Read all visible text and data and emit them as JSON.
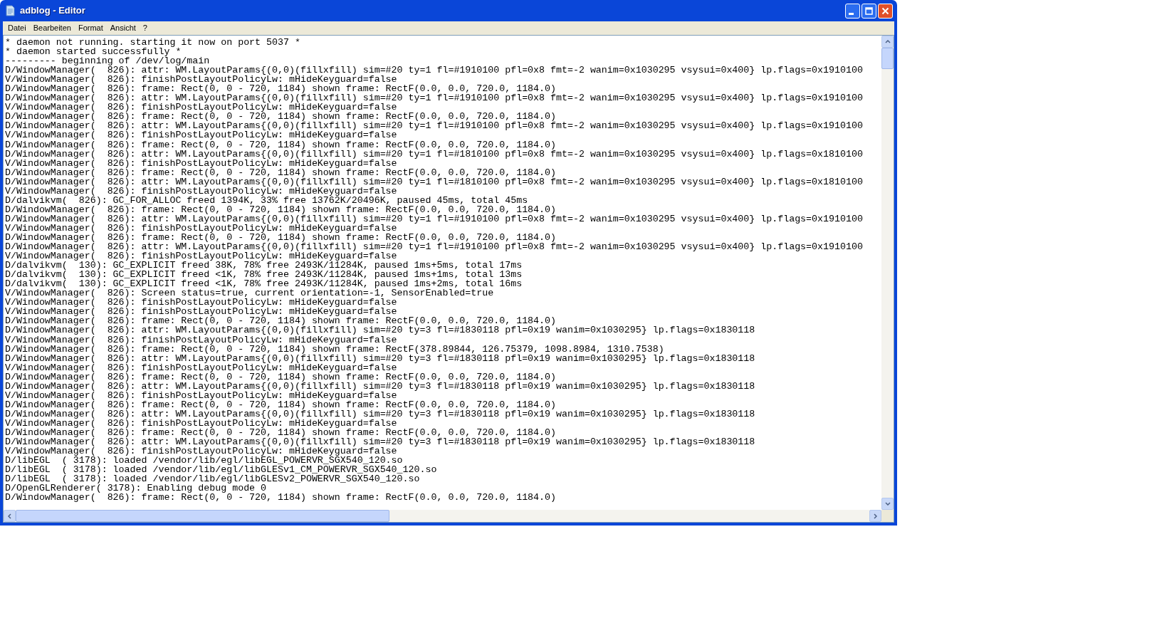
{
  "window": {
    "title": "adblog - Editor"
  },
  "menu": [
    {
      "label": "Datei"
    },
    {
      "label": "Bearbeiten"
    },
    {
      "label": "Format"
    },
    {
      "label": "Ansicht"
    },
    {
      "label": "?"
    }
  ],
  "lines": [
    "* daemon not running. starting it now on port 5037 *",
    "* daemon started successfully *",
    "--------- beginning of /dev/log/main",
    "D/WindowManager(  826): attr: WM.LayoutParams{(0,0)(fillxfill) sim=#20 ty=1 fl=#1910100 pfl=0x8 fmt=-2 wanim=0x1030295 vsysui=0x400} lp.flags=0x1910100",
    "V/WindowManager(  826): finishPostLayoutPolicyLw: mHideKeyguard=false",
    "D/WindowManager(  826): frame: Rect(0, 0 - 720, 1184) shown frame: RectF(0.0, 0.0, 720.0, 1184.0)",
    "D/WindowManager(  826): attr: WM.LayoutParams{(0,0)(fillxfill) sim=#20 ty=1 fl=#1910100 pfl=0x8 fmt=-2 wanim=0x1030295 vsysui=0x400} lp.flags=0x1910100",
    "V/WindowManager(  826): finishPostLayoutPolicyLw: mHideKeyguard=false",
    "D/WindowManager(  826): frame: Rect(0, 0 - 720, 1184) shown frame: RectF(0.0, 0.0, 720.0, 1184.0)",
    "D/WindowManager(  826): attr: WM.LayoutParams{(0,0)(fillxfill) sim=#20 ty=1 fl=#1910100 pfl=0x8 fmt=-2 wanim=0x1030295 vsysui=0x400} lp.flags=0x1910100",
    "V/WindowManager(  826): finishPostLayoutPolicyLw: mHideKeyguard=false",
    "D/WindowManager(  826): frame: Rect(0, 0 - 720, 1184) shown frame: RectF(0.0, 0.0, 720.0, 1184.0)",
    "D/WindowManager(  826): attr: WM.LayoutParams{(0,0)(fillxfill) sim=#20 ty=1 fl=#1810100 pfl=0x8 fmt=-2 wanim=0x1030295 vsysui=0x400} lp.flags=0x1810100",
    "V/WindowManager(  826): finishPostLayoutPolicyLw: mHideKeyguard=false",
    "D/WindowManager(  826): frame: Rect(0, 0 - 720, 1184) shown frame: RectF(0.0, 0.0, 720.0, 1184.0)",
    "D/WindowManager(  826): attr: WM.LayoutParams{(0,0)(fillxfill) sim=#20 ty=1 fl=#1810100 pfl=0x8 fmt=-2 wanim=0x1030295 vsysui=0x400} lp.flags=0x1810100",
    "V/WindowManager(  826): finishPostLayoutPolicyLw: mHideKeyguard=false",
    "D/dalvikvm(  826): GC_FOR_ALLOC freed 1394K, 33% free 13762K/20496K, paused 45ms, total 45ms",
    "D/WindowManager(  826): frame: Rect(0, 0 - 720, 1184) shown frame: RectF(0.0, 0.0, 720.0, 1184.0)",
    "D/WindowManager(  826): attr: WM.LayoutParams{(0,0)(fillxfill) sim=#20 ty=1 fl=#1910100 pfl=0x8 fmt=-2 wanim=0x1030295 vsysui=0x400} lp.flags=0x1910100",
    "V/WindowManager(  826): finishPostLayoutPolicyLw: mHideKeyguard=false",
    "D/WindowManager(  826): frame: Rect(0, 0 - 720, 1184) shown frame: RectF(0.0, 0.0, 720.0, 1184.0)",
    "D/WindowManager(  826): attr: WM.LayoutParams{(0,0)(fillxfill) sim=#20 ty=1 fl=#1910100 pfl=0x8 fmt=-2 wanim=0x1030295 vsysui=0x400} lp.flags=0x1910100",
    "V/WindowManager(  826): finishPostLayoutPolicyLw: mHideKeyguard=false",
    "D/dalvikvm(  130): GC_EXPLICIT freed 38K, 78% free 2493K/11284K, paused 1ms+5ms, total 17ms",
    "D/dalvikvm(  130): GC_EXPLICIT freed <1K, 78% free 2493K/11284K, paused 1ms+1ms, total 13ms",
    "D/dalvikvm(  130): GC_EXPLICIT freed <1K, 78% free 2493K/11284K, paused 1ms+2ms, total 16ms",
    "V/WindowManager(  826): Screen status=true, current orientation=-1, SensorEnabled=true",
    "V/WindowManager(  826): finishPostLayoutPolicyLw: mHideKeyguard=false",
    "V/WindowManager(  826): finishPostLayoutPolicyLw: mHideKeyguard=false",
    "D/WindowManager(  826): frame: Rect(0, 0 - 720, 1184) shown frame: RectF(0.0, 0.0, 720.0, 1184.0)",
    "D/WindowManager(  826): attr: WM.LayoutParams{(0,0)(fillxfill) sim=#20 ty=3 fl=#1830118 pfl=0x19 wanim=0x1030295} lp.flags=0x1830118",
    "V/WindowManager(  826): finishPostLayoutPolicyLw: mHideKeyguard=false",
    "D/WindowManager(  826): frame: Rect(0, 0 - 720, 1184) shown frame: RectF(378.89844, 126.75379, 1098.8984, 1310.7538)",
    "D/WindowManager(  826): attr: WM.LayoutParams{(0,0)(fillxfill) sim=#20 ty=3 fl=#1830118 pfl=0x19 wanim=0x1030295} lp.flags=0x1830118",
    "V/WindowManager(  826): finishPostLayoutPolicyLw: mHideKeyguard=false",
    "D/WindowManager(  826): frame: Rect(0, 0 - 720, 1184) shown frame: RectF(0.0, 0.0, 720.0, 1184.0)",
    "D/WindowManager(  826): attr: WM.LayoutParams{(0,0)(fillxfill) sim=#20 ty=3 fl=#1830118 pfl=0x19 wanim=0x1030295} lp.flags=0x1830118",
    "V/WindowManager(  826): finishPostLayoutPolicyLw: mHideKeyguard=false",
    "D/WindowManager(  826): frame: Rect(0, 0 - 720, 1184) shown frame: RectF(0.0, 0.0, 720.0, 1184.0)",
    "D/WindowManager(  826): attr: WM.LayoutParams{(0,0)(fillxfill) sim=#20 ty=3 fl=#1830118 pfl=0x19 wanim=0x1030295} lp.flags=0x1830118",
    "V/WindowManager(  826): finishPostLayoutPolicyLw: mHideKeyguard=false",
    "D/WindowManager(  826): frame: Rect(0, 0 - 720, 1184) shown frame: RectF(0.0, 0.0, 720.0, 1184.0)",
    "D/WindowManager(  826): attr: WM.LayoutParams{(0,0)(fillxfill) sim=#20 ty=3 fl=#1830118 pfl=0x19 wanim=0x1030295} lp.flags=0x1830118",
    "V/WindowManager(  826): finishPostLayoutPolicyLw: mHideKeyguard=false",
    "D/libEGL  ( 3178): loaded /vendor/lib/egl/libEGL_POWERVR_SGX540_120.so",
    "D/libEGL  ( 3178): loaded /vendor/lib/egl/libGLESv1_CM_POWERVR_SGX540_120.so",
    "D/libEGL  ( 3178): loaded /vendor/lib/egl/libGLESv2_POWERVR_SGX540_120.so",
    "D/OpenGLRenderer( 3178): Enabling debug mode 0",
    "D/WindowManager(  826): frame: Rect(0, 0 - 720, 1184) shown frame: RectF(0.0, 0.0, 720.0, 1184.0)"
  ]
}
